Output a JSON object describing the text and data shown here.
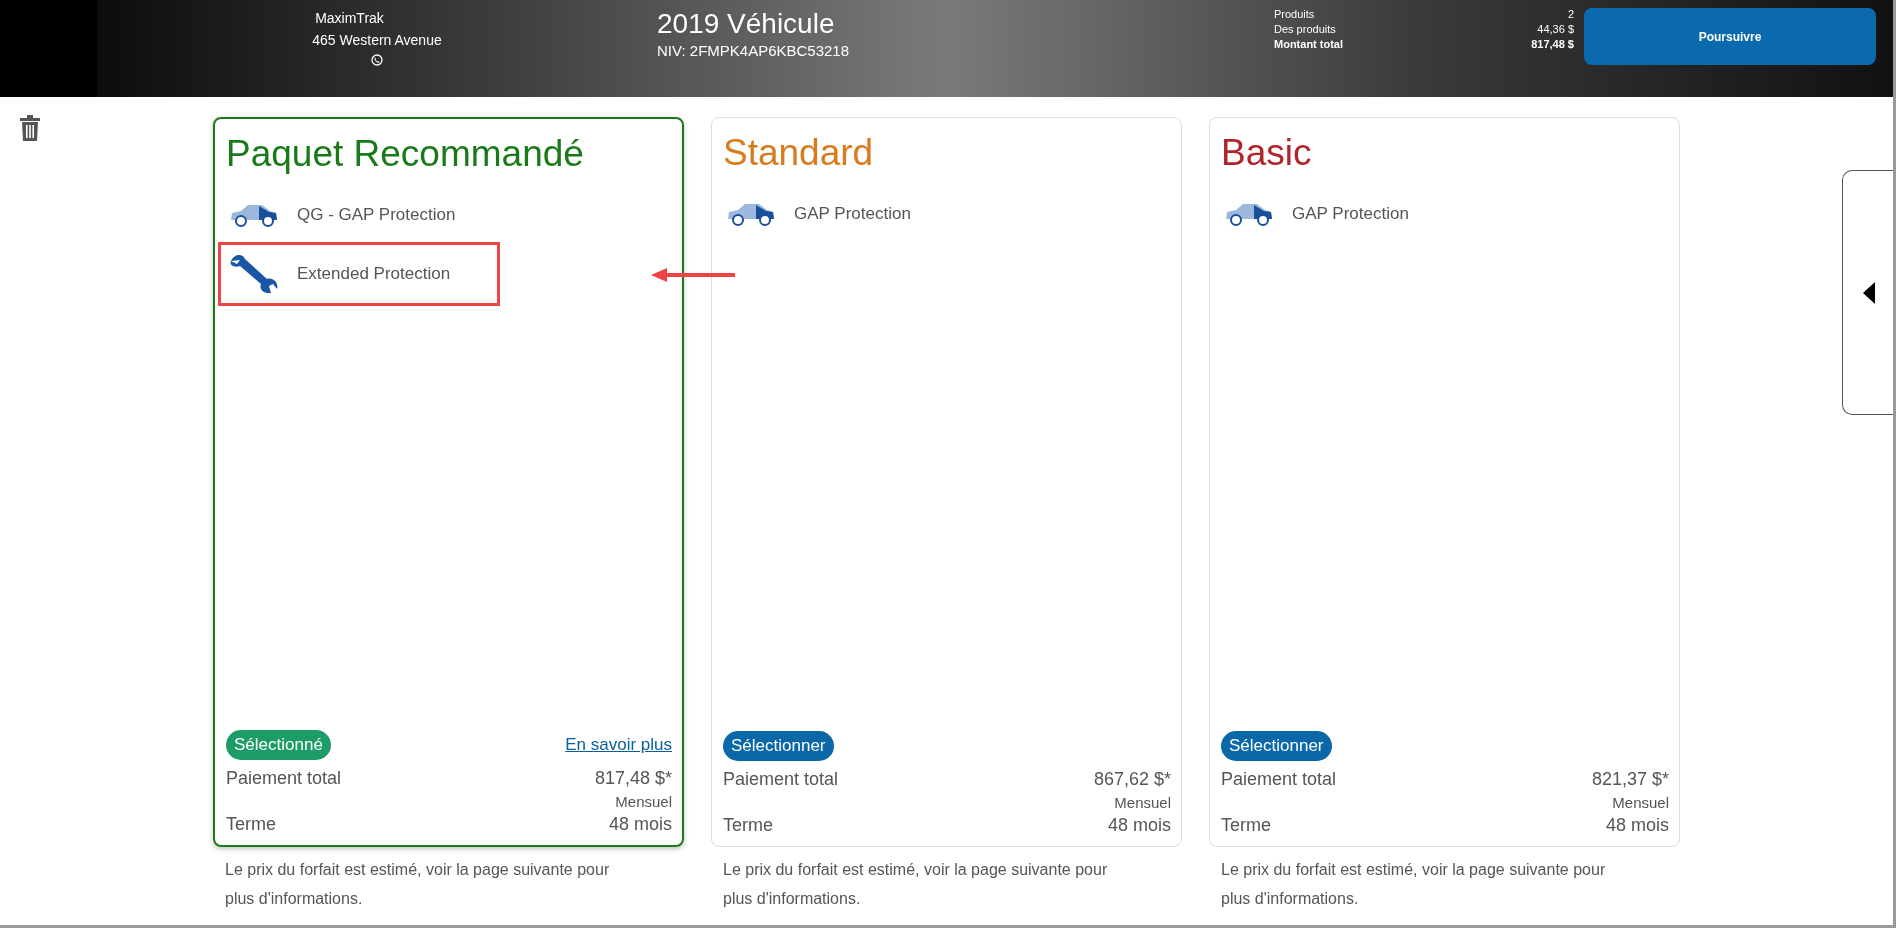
{
  "header": {
    "dealer_name": "MaximTrak",
    "dealer_address": "465 Western Avenue",
    "vehicle_title": "2019 Véhicule",
    "vin": "NIV: 2FMPK4AP6KBC53218",
    "summary": [
      {
        "label": "Produits",
        "value": "2",
        "bold": false
      },
      {
        "label": "Des produits",
        "value": "44,36 $",
        "bold": false
      },
      {
        "label": "Montant total",
        "value": "817,48 $",
        "bold": true
      }
    ],
    "continue_button": "Poursuivre"
  },
  "packages": [
    {
      "title": "Paquet Recommandé",
      "color": "#1a7a1a",
      "selected": true,
      "select_label": "Sélectionné",
      "more_link": "En savoir plus",
      "items": [
        {
          "kind": "car",
          "label": "QG - GAP Protection",
          "highlighted": false
        },
        {
          "kind": "wrench",
          "label": "Extended Protection",
          "highlighted": true
        }
      ],
      "payment_label": "Paiement total",
      "payment": "817,48 $*",
      "frequency": "Mensuel",
      "term_label": "Terme",
      "term": "48 mois",
      "note": "Le prix du forfait est estimé, voir la page suivante pour plus d'informations."
    },
    {
      "title": "Standard",
      "color": "#d97a1c",
      "selected": false,
      "select_label": "Sélectionner",
      "items": [
        {
          "kind": "car",
          "label": "GAP Protection",
          "highlighted": false
        }
      ],
      "payment_label": "Paiement total",
      "payment": "867,62 $*",
      "frequency": "Mensuel",
      "term_label": "Terme",
      "term": "48 mois",
      "note": "Le prix du forfait est estimé, voir la page suivante pour plus d'informations."
    },
    {
      "title": "Basic",
      "color": "#b3242a",
      "selected": false,
      "select_label": "Sélectionner",
      "items": [
        {
          "kind": "car",
          "label": "GAP Protection",
          "highlighted": false
        }
      ],
      "payment_label": "Paiement total",
      "payment": "821,37 $*",
      "frequency": "Mensuel",
      "term_label": "Terme",
      "term": "48 mois",
      "note": "Le prix du forfait est estimé, voir la page suivante pour plus d'informations."
    }
  ]
}
